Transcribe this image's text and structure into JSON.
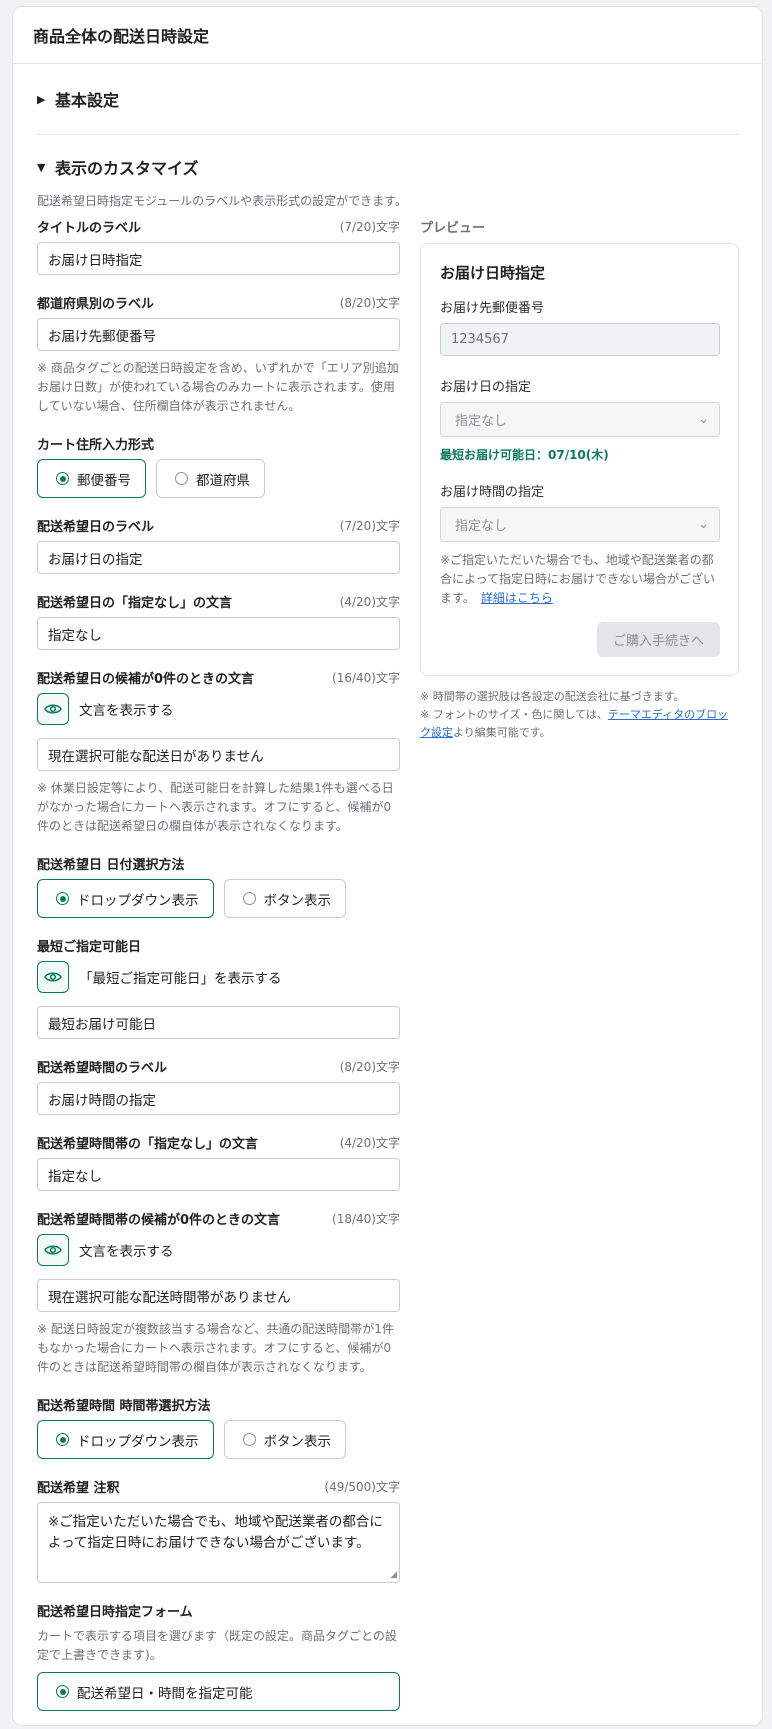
{
  "header": {
    "title": "商品全体の配送日時設定"
  },
  "basic": {
    "title": "基本設定"
  },
  "custom": {
    "title": "表示のカスタマイズ",
    "description": "配送希望日時指定モジュールのラベルや表示形式の設定ができます。"
  },
  "fields": {
    "title_label": {
      "label": "タイトルのラベル",
      "count": "(7/20)文字",
      "value": "お届け日時指定"
    },
    "pref_label": {
      "label": "都道府県別のラベル",
      "count": "(8/20)文字",
      "value": "お届け先郵便番号",
      "note": "※ 商品タグごとの配送日時設定を含め、いずれかで「エリア別追加お届け日数」が使われている場合のみカートに表示されます。使用していない場合、住所欄自体が表示されません。"
    },
    "address_format": {
      "label": "カート住所入力形式",
      "options": [
        "郵便番号",
        "都道府県"
      ]
    },
    "date_label": {
      "label": "配送希望日のラベル",
      "count": "(7/20)文字",
      "value": "お届け日の指定"
    },
    "date_none": {
      "label": "配送希望日の「指定なし」の文言",
      "count": "(4/20)文字",
      "value": "指定なし"
    },
    "date_empty": {
      "label": "配送希望日の候補が0件のときの文言",
      "count": "(16/40)文字",
      "toggle": "文言を表示する",
      "value": "現在選択可能な配送日がありません",
      "note": "※ 休業日設定等により、配送可能日を計算した結果1件も選べる日がなかった場合にカートへ表示されます。オフにすると、候補が0件のときは配送希望日の欄自体が表示されなくなります。"
    },
    "date_method": {
      "label": "配送希望日 日付選択方法",
      "options": [
        "ドロップダウン表示",
        "ボタン表示"
      ]
    },
    "earliest": {
      "label": "最短ご指定可能日",
      "toggle": "「最短ご指定可能日」を表示する",
      "value": "最短お届け可能日"
    },
    "time_label": {
      "label": "配送希望時間のラベル",
      "count": "(8/20)文字",
      "value": "お届け時間の指定"
    },
    "time_none": {
      "label": "配送希望時間帯の「指定なし」の文言",
      "count": "(4/20)文字",
      "value": "指定なし"
    },
    "time_empty": {
      "label": "配送希望時間帯の候補が0件のときの文言",
      "count": "(18/40)文字",
      "toggle": "文言を表示する",
      "value": "現在選択可能な配送時間帯がありません",
      "note": "※ 配送日時設定が複数該当する場合など、共通の配送時間帯が1件もなかった場合にカートへ表示されます。オフにすると、候補が0件のときは配送希望時間帯の欄自体が表示されなくなります。"
    },
    "time_method": {
      "label": "配送希望時間 時間帯選択方法",
      "options": [
        "ドロップダウン表示",
        "ボタン表示"
      ]
    },
    "remark": {
      "label": "配送希望 注釈",
      "count": "(49/500)文字",
      "value": "※ご指定いただいた場合でも、地域や配送業者の都合によって指定日時にお届けできない場合がございます。"
    },
    "form": {
      "label": "配送希望日時指定フォーム",
      "note": "カートで表示する項目を選びます（既定の設定。商品タグごとの設定で上書きできます)。",
      "option": "配送希望日・時間を指定可能"
    }
  },
  "preview": {
    "title": "プレビュー",
    "heading": "お届け日時指定",
    "zip_label": "お届け先郵便番号",
    "zip_value": "1234567",
    "date_label": "お届け日の指定",
    "date_value": "指定なし",
    "earliest": "最短お届け可能日：07/10(木)",
    "time_label": "お届け時間の指定",
    "time_value": "指定なし",
    "note": "※ご指定いただいた場合でも、地域や配送業者の都合によって指定日時にお届けできない場合がございます。",
    "link": "詳細はこちら",
    "button": "ご購入手続きへ",
    "foot1": "※ 時間帯の選択肢は各設定の配送会社に基づきます。",
    "foot2_pre": "※ フォントのサイズ・色に関しては、",
    "foot2_link": "テーマエディタのブロック設定",
    "foot2_post": "より編集可能です。"
  },
  "colors": {
    "accent": "#0b7a5c",
    "link": "#2c6ecb"
  }
}
